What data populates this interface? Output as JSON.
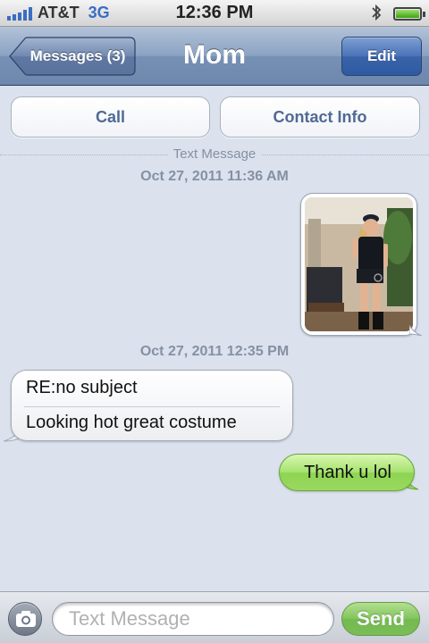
{
  "status_bar": {
    "carrier": "AT&T",
    "network": "3G",
    "time": "12:36 PM",
    "signal_bars": 5,
    "battery_level": 1.0
  },
  "nav": {
    "back_label": "Messages (3)",
    "title": "Mom",
    "edit_label": "Edit"
  },
  "actions": {
    "call_label": "Call",
    "contact_info_label": "Contact Info"
  },
  "conversation": {
    "type_label": "Text Message",
    "timestamp_1": "Oct 27, 2011 11:36 AM",
    "timestamp_2": "Oct 27, 2011 12:35 PM",
    "incoming": {
      "subject": "RE:no subject",
      "text": "Looking hot great costume"
    },
    "outgoing": {
      "text": "Thank u lol"
    }
  },
  "composer": {
    "placeholder": "Text Message",
    "value": "",
    "send_label": "Send"
  },
  "colors": {
    "accent_blue": "#3a6ec3",
    "outgoing_green": "#9ad860",
    "background": "#dbe2ed"
  },
  "icons": [
    "signal-icon",
    "bluetooth-icon",
    "battery-icon",
    "camera-icon"
  ]
}
